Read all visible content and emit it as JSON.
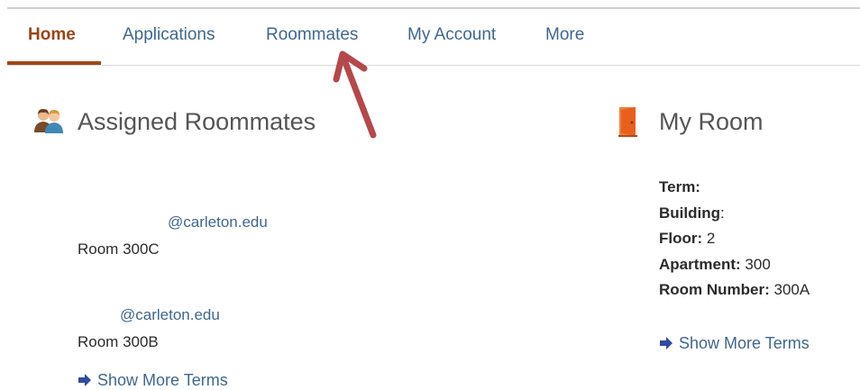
{
  "nav": {
    "tabs": [
      {
        "label": "Home",
        "active": true
      },
      {
        "label": "Applications",
        "active": false
      },
      {
        "label": "Roommates",
        "active": false
      },
      {
        "label": "My Account",
        "active": false
      },
      {
        "label": "More",
        "active": false
      }
    ]
  },
  "assigned_roommates": {
    "title": "Assigned Roommates",
    "roommates": [
      {
        "email": "@carleton.edu",
        "room": "Room 300C"
      },
      {
        "email": "@carleton.edu",
        "room": "Room 300B"
      }
    ],
    "show_more_label": "Show More Terms"
  },
  "my_room": {
    "title": "My Room",
    "term_label": "Term:",
    "term_value": "",
    "building_label": "Building",
    "building_colon": ":",
    "building_value": "",
    "floor_label": "Floor:",
    "floor_value": "2",
    "apartment_label": "Apartment:",
    "apartment_value": "300",
    "room_number_label": "Room Number:",
    "room_number_value": "300A",
    "show_more_label": "Show More Terms"
  },
  "colors": {
    "accent": "#a34717",
    "link": "#3f6790",
    "annotation_arrow": "#b5484b",
    "door_icon": "#e8601c"
  }
}
